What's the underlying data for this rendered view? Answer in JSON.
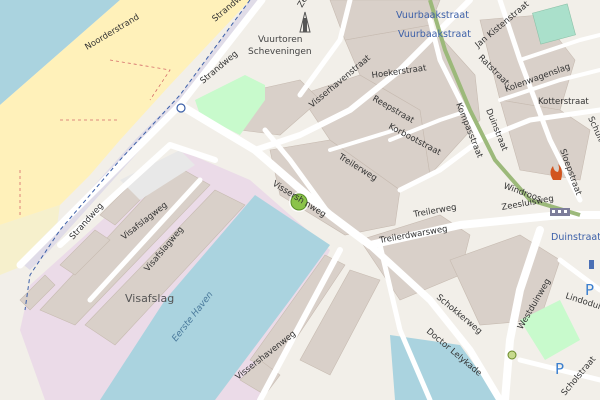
{
  "map": {
    "labels": {
      "noorderstrand": "Noorderstrand",
      "strandweg_top": "Strandweg",
      "strandweg_upper": "Strandweg",
      "strandweg_left": "Strandweg",
      "visafslagweg": "Visafslagweg",
      "visafslagweg2": "Visafslagweg",
      "visafslag": "Visafslag",
      "eerste_haven": "Eerste Haven",
      "vissershavenweg_bottom": "Vissershavenweg",
      "visserhavenweg_mid": "Vissersh   nweg",
      "visserhavenstraat": "Visserhavenstraat",
      "hoekerstraat": "Hoekerstraat",
      "reepstraat": "Reepstraat",
      "korbootstraat": "Korbootstraat",
      "treilerweg": "Treilerweg",
      "treilerweg2": "Treilerweg",
      "treilerdwarsweg": "Treilerdwarsweg",
      "zeesluisweg": "Zeesluisweg",
      "kompasstraat": "Kompasstraat",
      "duinstraat": "Duinstraat",
      "vuurbaakstraat_1": "Vuurbaakstraat",
      "vuurbaakstraat_2": "Vuurbaakstraat",
      "jan_kistenstraat": "Jan Kistenstraat",
      "kotterstraat": "Kotterstraat",
      "kolenwagenslag": "Kolenwagenslag",
      "ratstraat": "Ratstraat",
      "sloepstraat": "Sloepstraat",
      "windroos": "Windroos",
      "schokkerweg": "Schokkerweg",
      "westduinweg": "Westduinweg",
      "doctor_lelykade": "Doctor Lelykade",
      "duinstraat_right": "Duinstraat",
      "lindoduin": "Lindoduin",
      "scholstraat": "Scholstraat",
      "schuitenstr": "Schuite",
      "vuurtoren_1": "Vuurtoren",
      "vuurtoren_2": "Scheveningen",
      "zee_top": "Zee",
      "vd_kiste": "Kiste"
    },
    "colors": {
      "sea": "#aad3df",
      "beach": "#fff1ba",
      "land": "#f2efe9",
      "industrial": "#ebdbe8",
      "building": "#d9d0c9",
      "road": "#ffffff",
      "rail": "#9cb97a",
      "marker": "#8bc34a"
    },
    "marker": {
      "name": "location-marker"
    },
    "icons": [
      "lighthouse-icon",
      "fire-station-icon",
      "parking-icon",
      "bus-stop-icon",
      "train-station-icon"
    ]
  }
}
